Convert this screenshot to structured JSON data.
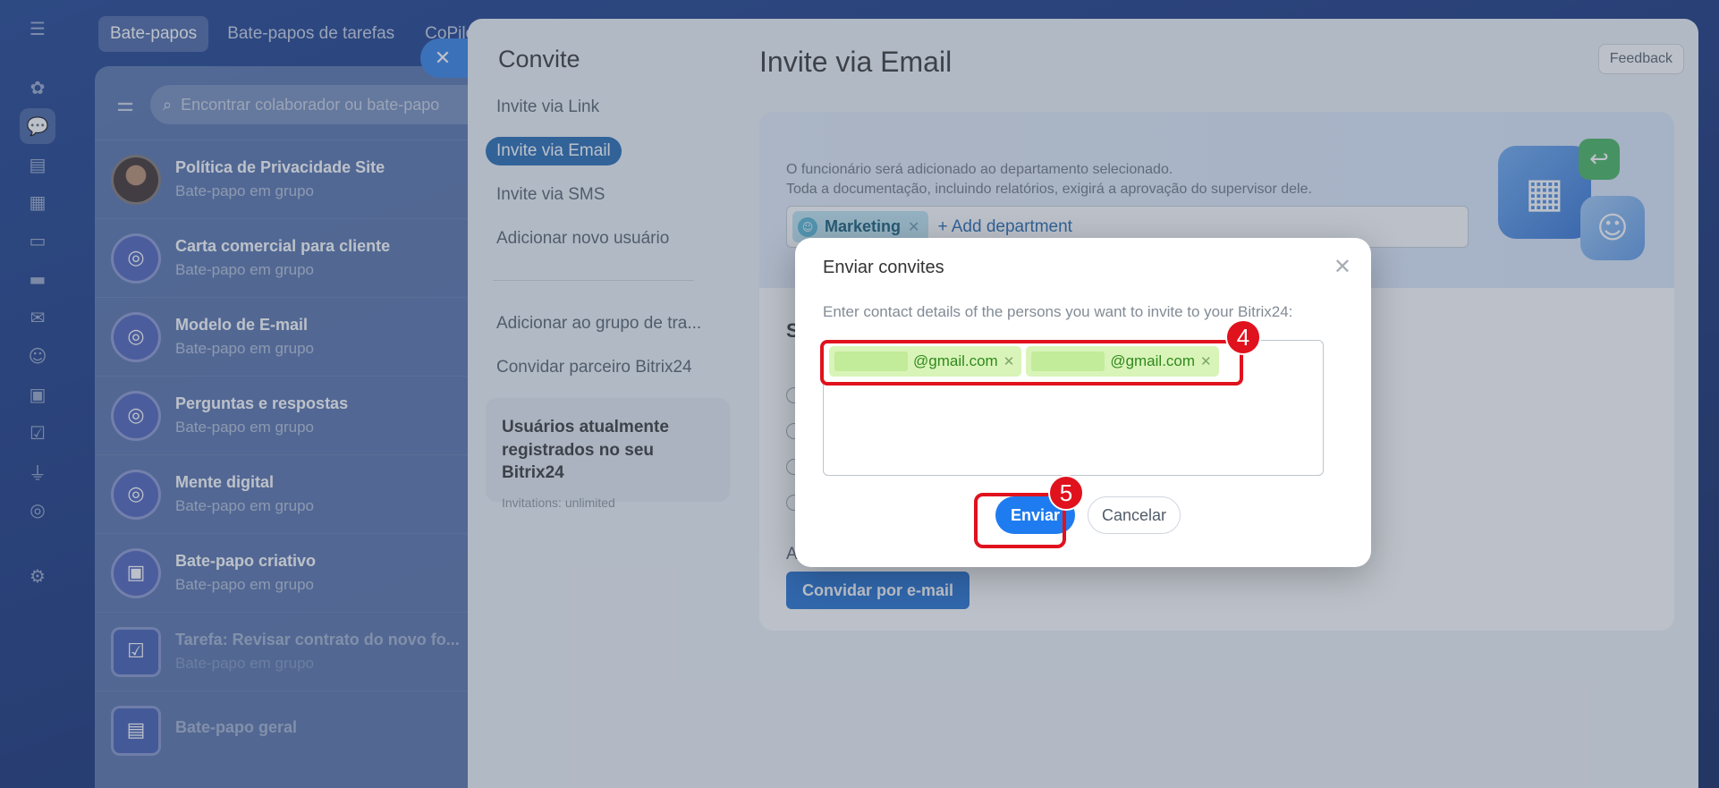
{
  "top_tabs": [
    "Bate-papos",
    "Bate-papos de tarefas",
    "CoPilot"
  ],
  "chat_panel": {
    "search_placeholder": "Encontrar colaborador ou bate-papo",
    "chats": [
      {
        "title": "Política de Privacidade Site",
        "subtitle": "Bate-papo em grupo"
      },
      {
        "title": "Carta comercial para cliente",
        "subtitle": "Bate-papo em grupo"
      },
      {
        "title": "Modelo de E-mail",
        "subtitle": "Bate-papo em grupo"
      },
      {
        "title": "Perguntas e respostas",
        "subtitle": "Bate-papo em grupo"
      },
      {
        "title": "Mente digital",
        "subtitle": "Bate-papo em grupo"
      },
      {
        "title": "Bate-papo criativo",
        "subtitle": "Bate-papo em grupo"
      },
      {
        "title": "Tarefa: Revisar contrato do novo fo...",
        "subtitle": "Bate-papo em grupo"
      },
      {
        "title": "Bate-papo geral",
        "subtitle": ""
      }
    ]
  },
  "invite_nav": {
    "title": "Convite",
    "items": [
      "Invite via Link",
      "Invite via Email",
      "Invite via SMS",
      "Adicionar novo usuário"
    ],
    "active_item": "Invite via Email",
    "secondary_items": [
      "Adicionar ao grupo de tra...",
      "Convidar parceiro Bitrix24"
    ],
    "usage_card": {
      "title": "Usuários atualmente registrados no seu Bitrix24",
      "subtitle": "Invitations: unlimited"
    }
  },
  "invite_main": {
    "title": "Invite via Email",
    "feedback_label": "Feedback",
    "banner_line1": "O funcionário será adicionado ao departamento selecionado.",
    "banner_line2": "Toda a documentação, incluindo relatórios, exigirá a aprovação do supervisor dele.",
    "department_chip": "Marketing",
    "add_department": "+ Add department",
    "steps_letter": "S",
    "steps_extra": "A",
    "send_email_button": "Convidar por e-mail"
  },
  "dialog": {
    "title": "Enviar convites",
    "instruction": "Enter contact details of the persons you want to invite to your Bitrix24:",
    "emails": [
      {
        "domain": "@gmail.com"
      },
      {
        "domain": "@gmail.com"
      }
    ],
    "send_label": "Enviar",
    "cancel_label": "Cancelar"
  },
  "annotations": {
    "step_emails": "4",
    "step_send": "5",
    "highlight_color": "#e0121d"
  },
  "colors": {
    "accent": "#1f7cf0",
    "nav_active": "#2066b0",
    "email_chip": "#d9f4b8",
    "dept_chip": "#bfe6f3"
  }
}
